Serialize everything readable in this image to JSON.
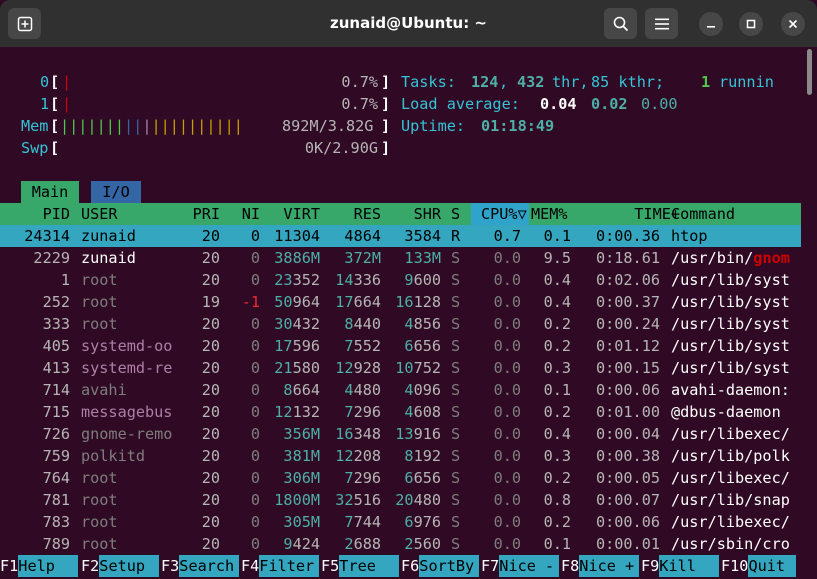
{
  "window": {
    "title": "zunaid@Ubuntu: ~"
  },
  "meters": {
    "cpu0": {
      "label": "0",
      "value": "0.7%"
    },
    "cpu1": {
      "label": "1",
      "value": "0.7%"
    },
    "mem": {
      "label": "Mem",
      "value": "892M/3.82G"
    },
    "swp": {
      "label": "Swp",
      "value": "0K/2.90G"
    },
    "tasks": {
      "label": "Tasks:",
      "tasks": "124",
      "thr": "432",
      "thr_label": "thr,",
      "kthr": "85 kthr;",
      "running": "1",
      "running_label": "runnin"
    },
    "load": {
      "label": "Load average:",
      "one": "0.04",
      "five": "0.02",
      "fifteen": "0.00"
    },
    "uptime": {
      "label": "Uptime:",
      "value": "01:18:49"
    }
  },
  "tabs": [
    {
      "label": "Main"
    },
    {
      "label": "I/O"
    }
  ],
  "columns": {
    "pid": "PID",
    "user": "USER",
    "pri": "PRI",
    "ni": "NI",
    "virt": "VIRT",
    "res": "RES",
    "shr": "SHR",
    "s": "S",
    "cpu": "CPU%▽",
    "mem": "MEM%",
    "time": "TIME+",
    "command": "Command"
  },
  "processes": [
    {
      "pid": "24314",
      "user": "zunaid",
      "pri": "20",
      "ni": "0",
      "virt": "11304",
      "res": "4864",
      "shr": "3584",
      "s": "R",
      "cpu": "0.7",
      "mem": "0.1",
      "time": "0:00.36",
      "command": "htop",
      "selected": true
    },
    {
      "pid": "2229",
      "user": "zunaid",
      "pri": "20",
      "ni": "0",
      "virt": "3886M",
      "res": "372M",
      "shr": "133M",
      "s": "S",
      "cpu": "0.0",
      "mem": "9.5",
      "time": "0:18.61",
      "command": "/usr/bin/",
      "command_hl": "gnom"
    },
    {
      "pid": "1",
      "user": "root",
      "pri": "20",
      "ni": "0",
      "virt": "23352",
      "res": "14336",
      "shr": "9600",
      "s": "S",
      "cpu": "0.0",
      "mem": "0.4",
      "time": "0:02.06",
      "command": "/usr/lib/syst"
    },
    {
      "pid": "252",
      "user": "root",
      "pri": "19",
      "ni": "-1",
      "virt": "50964",
      "res": "17664",
      "shr": "16128",
      "s": "S",
      "cpu": "0.0",
      "mem": "0.4",
      "time": "0:00.37",
      "command": "/usr/lib/syst"
    },
    {
      "pid": "333",
      "user": "root",
      "pri": "20",
      "ni": "0",
      "virt": "30432",
      "res": "8440",
      "shr": "4856",
      "s": "S",
      "cpu": "0.0",
      "mem": "0.2",
      "time": "0:00.24",
      "command": "/usr/lib/syst"
    },
    {
      "pid": "405",
      "user": "systemd-oo",
      "pri": "20",
      "ni": "0",
      "virt": "17596",
      "res": "7552",
      "shr": "6656",
      "s": "S",
      "cpu": "0.0",
      "mem": "0.2",
      "time": "0:01.12",
      "command": "/usr/lib/syst"
    },
    {
      "pid": "413",
      "user": "systemd-re",
      "pri": "20",
      "ni": "0",
      "virt": "21580",
      "res": "12928",
      "shr": "10752",
      "s": "S",
      "cpu": "0.0",
      "mem": "0.3",
      "time": "0:00.15",
      "command": "/usr/lib/syst"
    },
    {
      "pid": "714",
      "user": "avahi",
      "pri": "20",
      "ni": "0",
      "virt": "8664",
      "res": "4480",
      "shr": "4096",
      "s": "S",
      "cpu": "0.0",
      "mem": "0.1",
      "time": "0:00.06",
      "command": "avahi-daemon:"
    },
    {
      "pid": "715",
      "user": "messagebus",
      "pri": "20",
      "ni": "0",
      "virt": "12132",
      "res": "7296",
      "shr": "4608",
      "s": "S",
      "cpu": "0.0",
      "mem": "0.2",
      "time": "0:01.00",
      "command": "@dbus-daemon"
    },
    {
      "pid": "726",
      "user": "gnome-remo",
      "pri": "20",
      "ni": "0",
      "virt": "356M",
      "res": "16348",
      "shr": "13916",
      "s": "S",
      "cpu": "0.0",
      "mem": "0.4",
      "time": "0:00.04",
      "command": "/usr/libexec/"
    },
    {
      "pid": "759",
      "user": "polkitd",
      "pri": "20",
      "ni": "0",
      "virt": "381M",
      "res": "12208",
      "shr": "8192",
      "s": "S",
      "cpu": "0.0",
      "mem": "0.3",
      "time": "0:00.38",
      "command": "/usr/lib/polk"
    },
    {
      "pid": "764",
      "user": "root",
      "pri": "20",
      "ni": "0",
      "virt": "306M",
      "res": "7296",
      "shr": "6656",
      "s": "S",
      "cpu": "0.0",
      "mem": "0.2",
      "time": "0:00.05",
      "command": "/usr/libexec/"
    },
    {
      "pid": "781",
      "user": "root",
      "pri": "20",
      "ni": "0",
      "virt": "1800M",
      "res": "32516",
      "shr": "20480",
      "s": "S",
      "cpu": "0.0",
      "mem": "0.8",
      "time": "0:00.07",
      "command": "/usr/lib/snap"
    },
    {
      "pid": "783",
      "user": "root",
      "pri": "20",
      "ni": "0",
      "virt": "305M",
      "res": "7744",
      "shr": "6976",
      "s": "S",
      "cpu": "0.0",
      "mem": "0.2",
      "time": "0:00.06",
      "command": "/usr/libexec/"
    },
    {
      "pid": "789",
      "user": "root",
      "pri": "20",
      "ni": "0",
      "virt": "9424",
      "res": "2688",
      "shr": "2560",
      "s": "S",
      "cpu": "0.0",
      "mem": "0.1",
      "time": "0:00.01",
      "command": "/usr/sbin/cro"
    }
  ],
  "function_keys": [
    {
      "key": "F1",
      "label": "Help"
    },
    {
      "key": "F2",
      "label": "Setup"
    },
    {
      "key": "F3",
      "label": "Search"
    },
    {
      "key": "F4",
      "label": "Filter"
    },
    {
      "key": "F5",
      "label": "Tree"
    },
    {
      "key": "F6",
      "label": "SortBy"
    },
    {
      "key": "F7",
      "label": "Nice -"
    },
    {
      "key": "F8",
      "label": "Nice +"
    },
    {
      "key": "F9",
      "label": "Kill"
    },
    {
      "key": "F10",
      "label": "Quit"
    }
  ],
  "colors": {
    "terminal_bg": "#300a24",
    "titlebar": "#303030",
    "header_green": "#37a86a",
    "selection_cyan": "#34a6bf"
  }
}
